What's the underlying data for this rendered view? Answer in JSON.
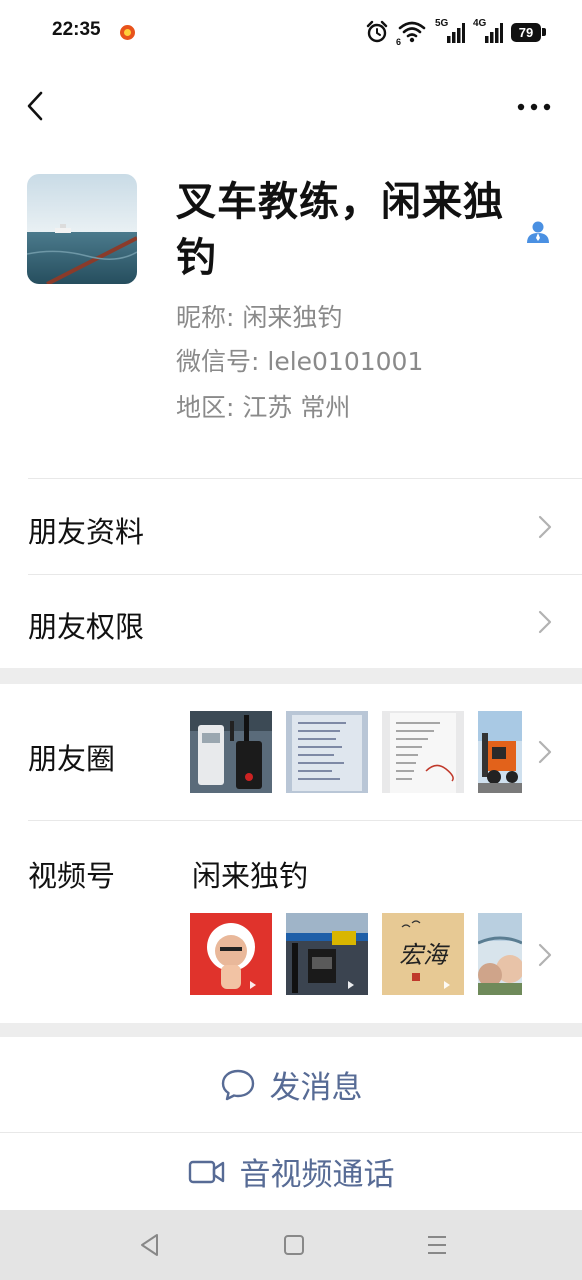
{
  "status_bar": {
    "time": "22:35",
    "net_5g": "5G",
    "net_4g": "4G",
    "wifi_badge": "6",
    "battery": "79",
    "icons": [
      "app-notification-icon",
      "alarm-icon",
      "wifi-icon",
      "signal-5g-icon",
      "signal-4g-icon",
      "battery-icon"
    ]
  },
  "nav": {
    "back_icon": "chevron-left-icon",
    "more_icon": "more-dots-icon"
  },
  "profile": {
    "name": "叉车教练，闲来独钓",
    "nickname_line": "昵称: 闲来独钓",
    "wechat_id_line": "微信号: lele0101001",
    "region_line": "地区: 江苏 常州",
    "star_icon": "star-friend-icon"
  },
  "rows": {
    "friend_info": "朋友资料",
    "friend_permissions": "朋友权限",
    "moments": "朋友圈",
    "channels": "视频号",
    "channel_name": "闲来独钓"
  },
  "moments_thumbs": [
    "walkie-talkie photo",
    "handwritten list photo",
    "notebook list photo",
    "forklift photo"
  ],
  "channel_thumbs": [
    "portrait video",
    "forklift video",
    "calligraphy 宏海 video",
    "selfie video"
  ],
  "calligraphy_text": "宏海",
  "actions": {
    "message": "发消息",
    "call": "音视频通话"
  },
  "colors": {
    "link_blue": "#576b95",
    "star_blue": "#4a90e2",
    "gray_text": "#8a8a8a",
    "band": "#ededed"
  }
}
